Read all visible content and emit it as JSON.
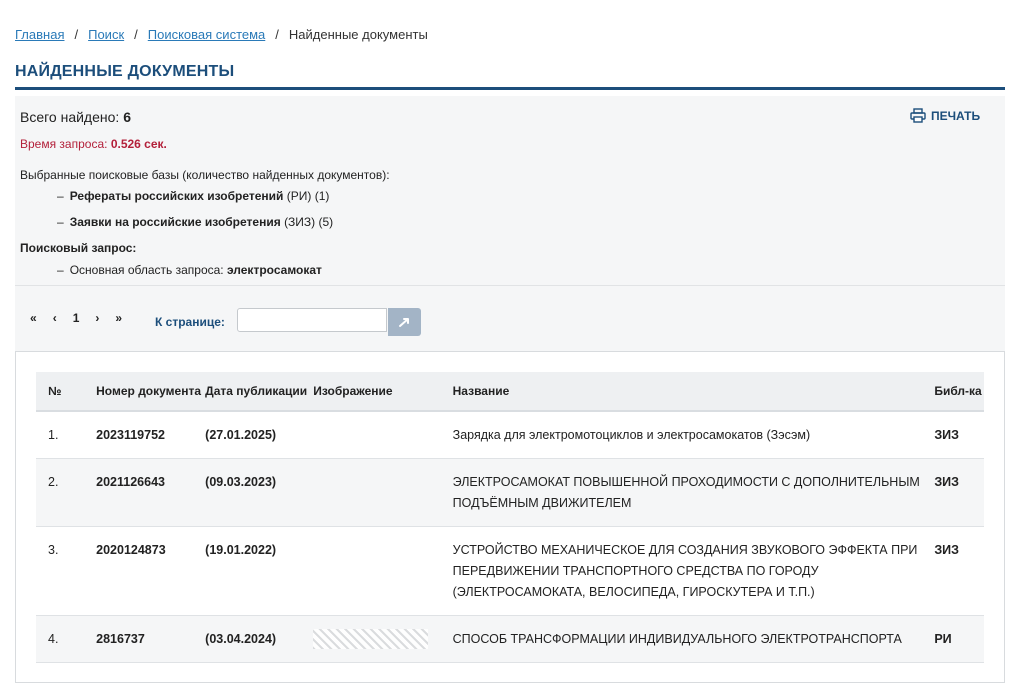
{
  "breadcrumb": {
    "items": [
      {
        "label": "Главная",
        "link": true
      },
      {
        "label": "Поиск",
        "link": true
      },
      {
        "label": "Поисковая система",
        "link": true
      },
      {
        "label": "Найденные документы",
        "link": false
      }
    ],
    "separator": "/"
  },
  "page_title": "НАЙДЕННЫЕ ДОКУМЕНТЫ",
  "summary": {
    "total_label": "Всего найдено:",
    "total_value": "6",
    "print_label": "ПЕЧАТЬ",
    "query_time_label": "Время запроса:",
    "query_time_value": "0.526 сек.",
    "databases_title": "Выбранные поисковые базы (количество найденных документов):",
    "databases": [
      {
        "name": "Рефераты российских изобретений",
        "suffix": "(РИ) (1)"
      },
      {
        "name": "Заявки на российские изобретения",
        "suffix": "(ЗИЗ) (5)"
      }
    ],
    "search_query_title": "Поисковый запрос:",
    "search_query_area_label": "Основная область запроса:",
    "search_query_value": "электросамокат"
  },
  "pager": {
    "first": "«",
    "prev": "‹",
    "current": "1",
    "next": "›",
    "last": "»",
    "goto_label": "К странице:",
    "goto_value": ""
  },
  "table": {
    "headers": {
      "num": "№",
      "doc_number": "Номер документа",
      "pub_date": "Дата публикации",
      "image": "Изображение",
      "title": "Название",
      "library": "Библ-ка"
    },
    "rows": [
      {
        "num": "1.",
        "doc": "2023119752",
        "date": "(27.01.2025)",
        "title": "Зарядка для электромотоциклов и электросамокатов (Зэсэм)",
        "lib": "ЗИЗ",
        "has_image": false
      },
      {
        "num": "2.",
        "doc": "2021126643",
        "date": "(09.03.2023)",
        "title": "ЭЛЕКТРОСАМОКАТ ПОВЫШЕННОЙ ПРОХОДИМОСТИ С ДОПОЛНИТЕЛЬНЫМ ПОДЪЁМНЫМ ДВИЖИТЕЛЕМ",
        "lib": "ЗИЗ",
        "has_image": false
      },
      {
        "num": "3.",
        "doc": "2020124873",
        "date": "(19.01.2022)",
        "title": "УСТРОЙСТВО МЕХАНИЧЕСКОЕ ДЛЯ СОЗДАНИЯ ЗВУКОВОГО ЭФФЕКТА ПРИ ПЕРЕДВИЖЕНИИ ТРАНСПОРТНОГО СРЕДСТВА ПО ГОРОДУ (ЭЛЕКТРОСАМОКАТА, ВЕЛОСИПЕДА, ГИРОСКУТЕРА И Т.П.)",
        "lib": "ЗИЗ",
        "has_image": false
      },
      {
        "num": "4.",
        "doc": "2816737",
        "date": "(03.04.2024)",
        "title": "СПОСОБ ТРАНСФОРМАЦИИ ИНДИВИДУАЛЬНОГО ЭЛЕКТРОТРАНСПОРТА",
        "lib": "РИ",
        "has_image": true
      }
    ]
  },
  "colors": {
    "accent": "#1c4e7b",
    "link": "#2a7ab8",
    "query_time": "#b3203a",
    "panel_bg": "#f5f6f7"
  }
}
